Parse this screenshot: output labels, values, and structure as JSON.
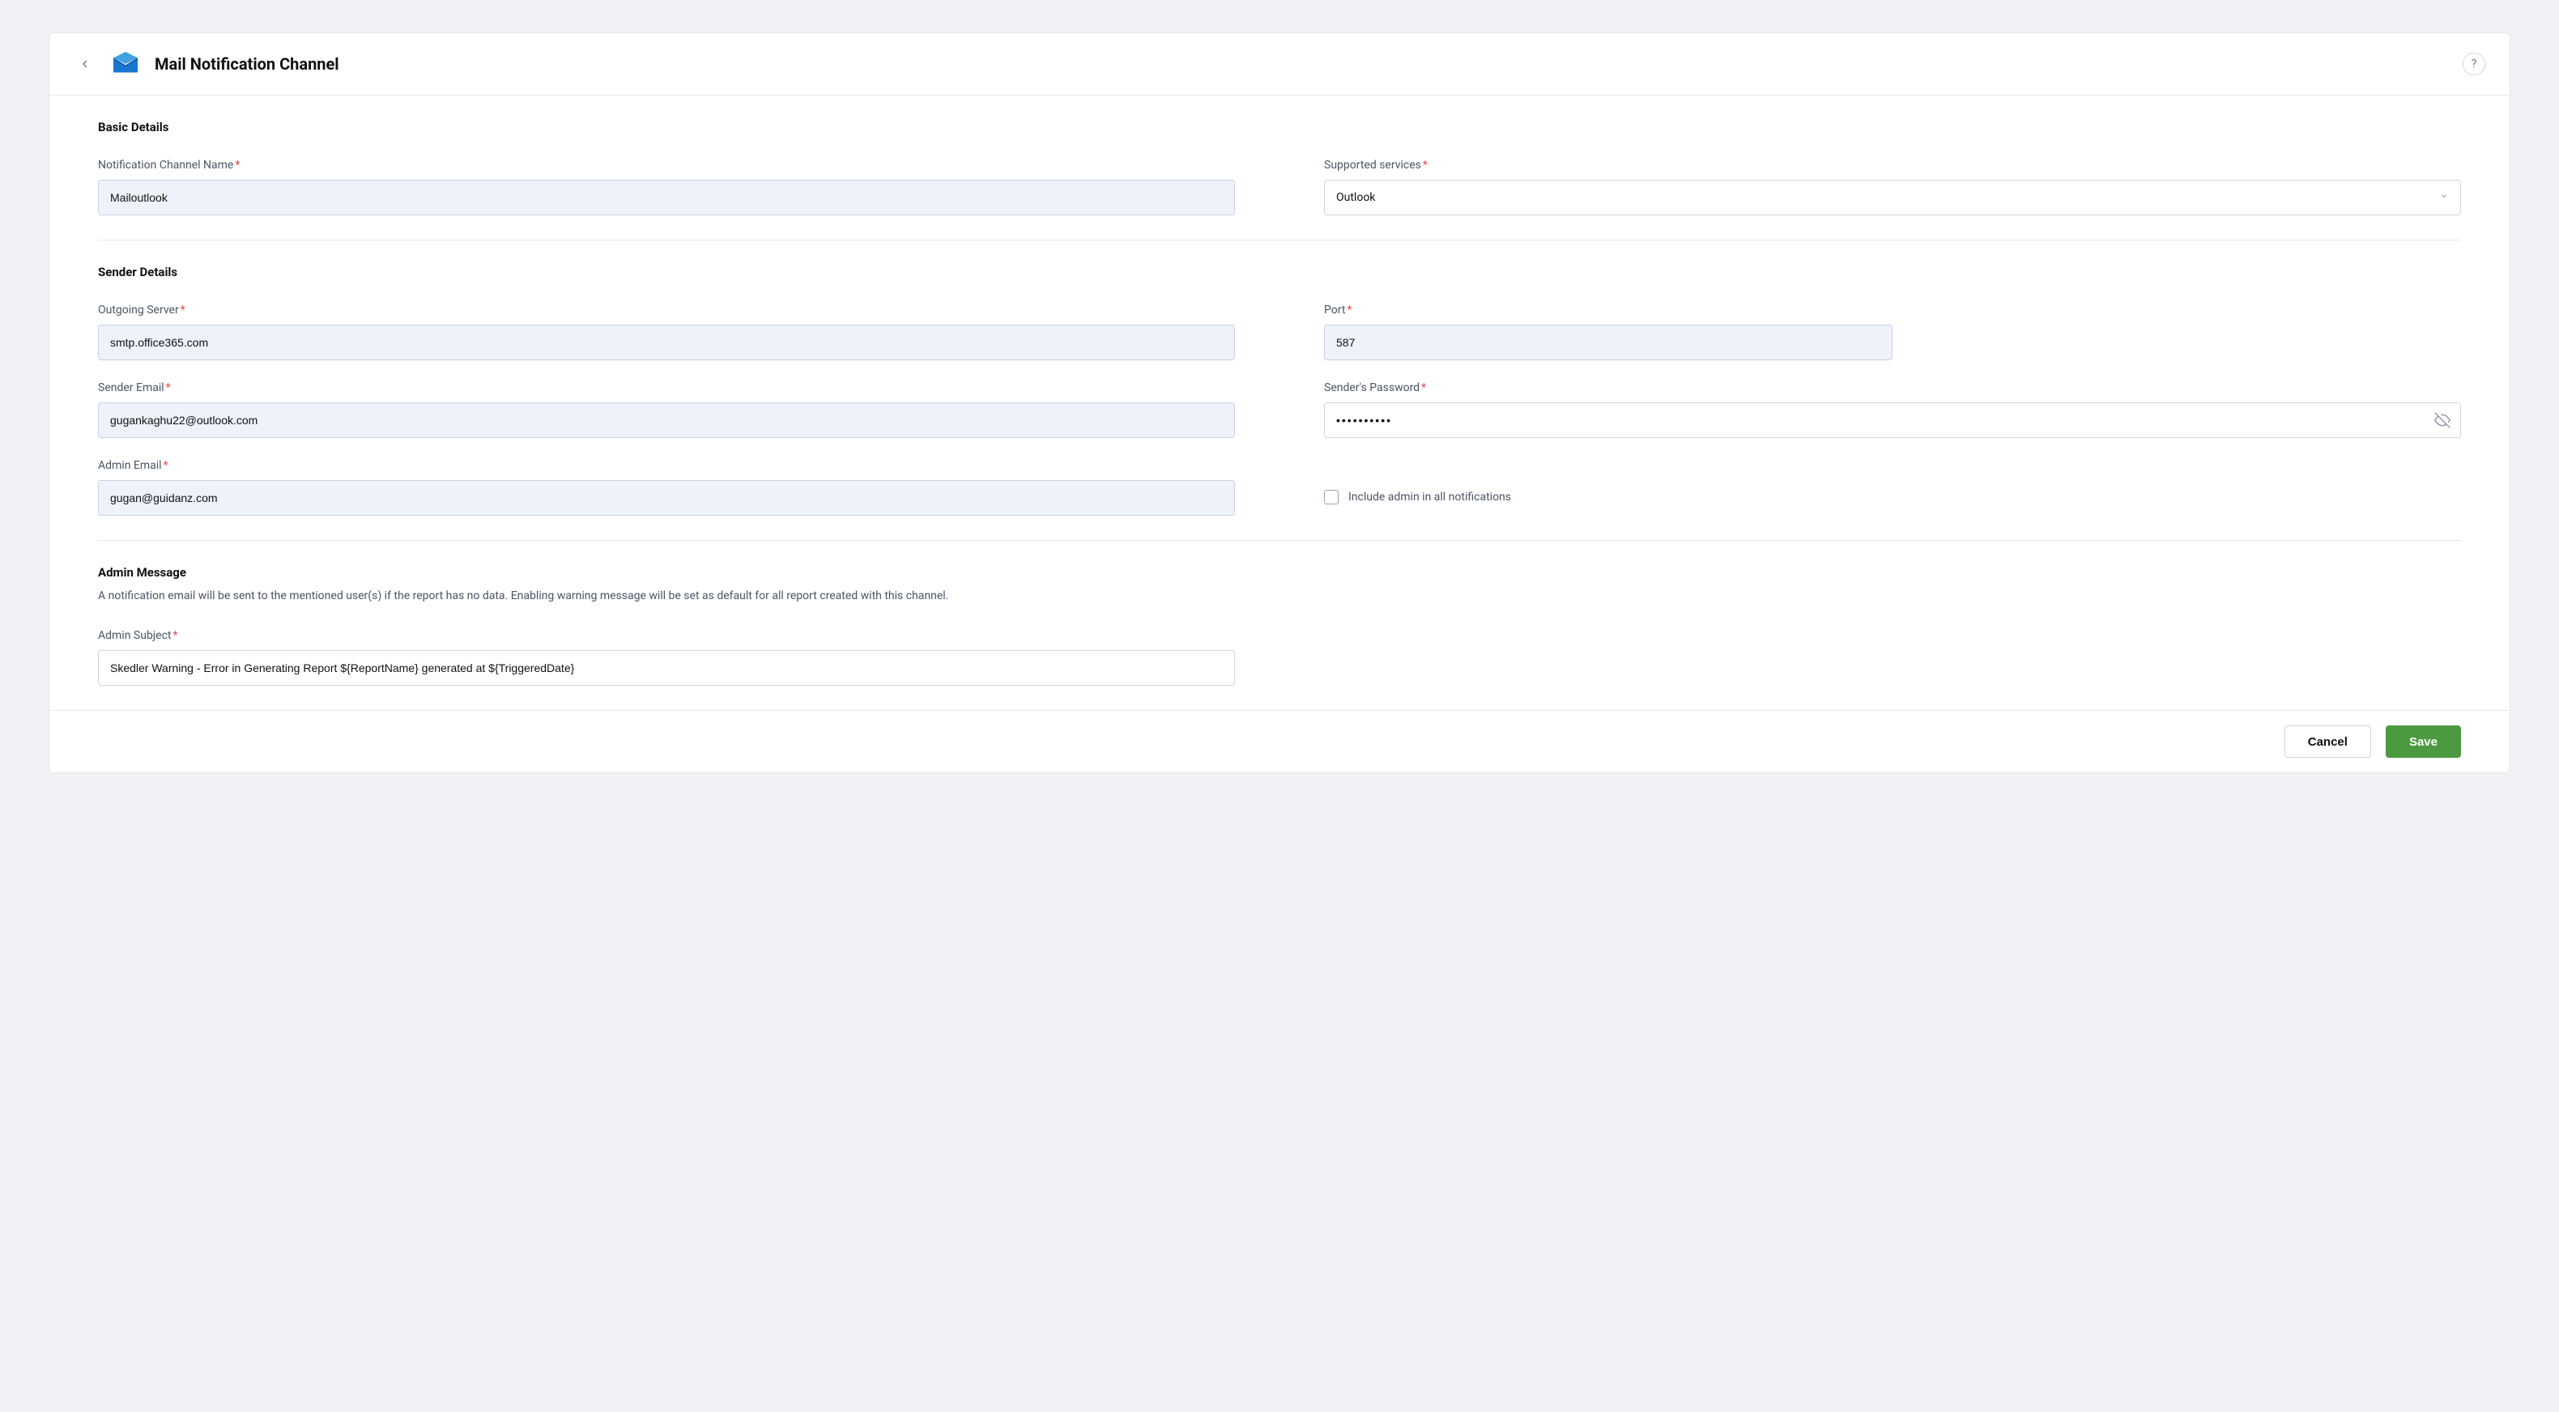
{
  "header": {
    "title": "Mail Notification Channel",
    "help": "?"
  },
  "sections": {
    "basic": {
      "title": "Basic Details",
      "channel_name_label": "Notification Channel Name",
      "channel_name_value": "Mailoutlook",
      "services_label": "Supported services",
      "services_value": "Outlook"
    },
    "sender": {
      "title": "Sender Details",
      "server_label": "Outgoing Server",
      "server_value": "smtp.office365.com",
      "port_label": "Port",
      "port_value": "587",
      "sender_email_label": "Sender Email",
      "sender_email_value": "gugankaghu22@outlook.com",
      "password_label": "Sender's Password",
      "password_value": "••••••••••",
      "admin_email_label": "Admin Email",
      "admin_email_value": "gugan@guidanz.com",
      "include_admin_label": "Include admin in all notifications"
    },
    "admin_message": {
      "title": "Admin Message",
      "description": "A notification email will be sent to the mentioned user(s) if the report has no data. Enabling warning message will be set as default for all report created with this channel.",
      "subject_label": "Admin Subject",
      "subject_value": "Skedler Warning - Error in Generating Report ${ReportName} generated at ${TriggeredDate}"
    }
  },
  "footer": {
    "cancel": "Cancel",
    "save": "Save"
  }
}
